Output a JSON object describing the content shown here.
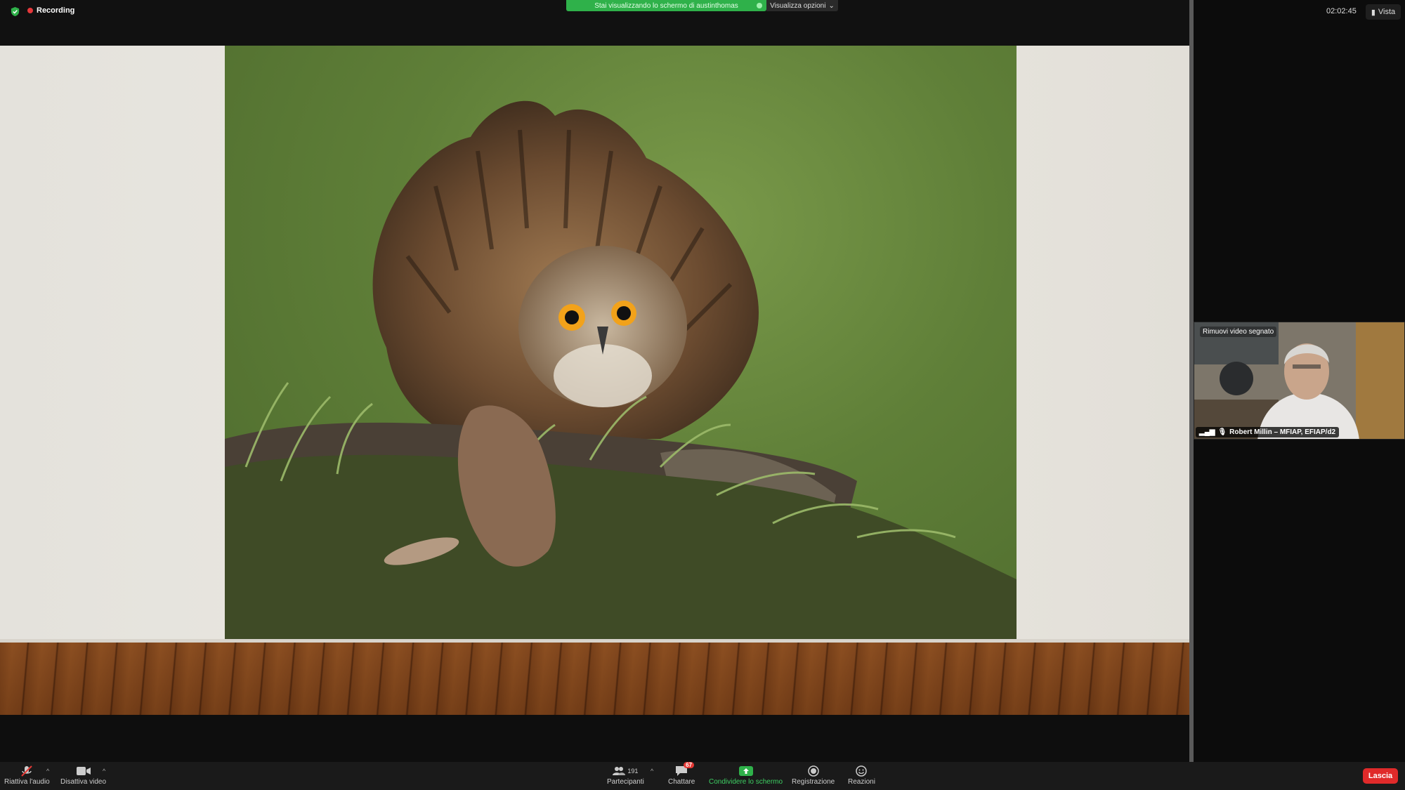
{
  "colors": {
    "accent_green": "#2fb14a",
    "record_red": "#e5383b",
    "leave_red": "#e02a2a"
  },
  "top": {
    "recording_label": "Recording",
    "share_banner": "Stai visualizzando lo schermo di austinthomas",
    "view_options": "Visualizza opzioni",
    "timer": "02:02:45",
    "view_button": "Vista"
  },
  "video_tile": {
    "overlay_label": "Rimuovi video segnato",
    "participant_name": "Robert Millin – MFIAP, EFIAP/d2"
  },
  "toolbar": {
    "audio_label": "Riattiva l'audio",
    "video_label": "Disattiva video",
    "participants_label": "Partecipanti",
    "participants_count": "191",
    "chat_label": "Chattare",
    "chat_badge": "67",
    "share_label": "Condividere lo schermo",
    "record_label": "Registrazione",
    "reactions_label": "Reazioni",
    "leave_label": "Lascia"
  }
}
